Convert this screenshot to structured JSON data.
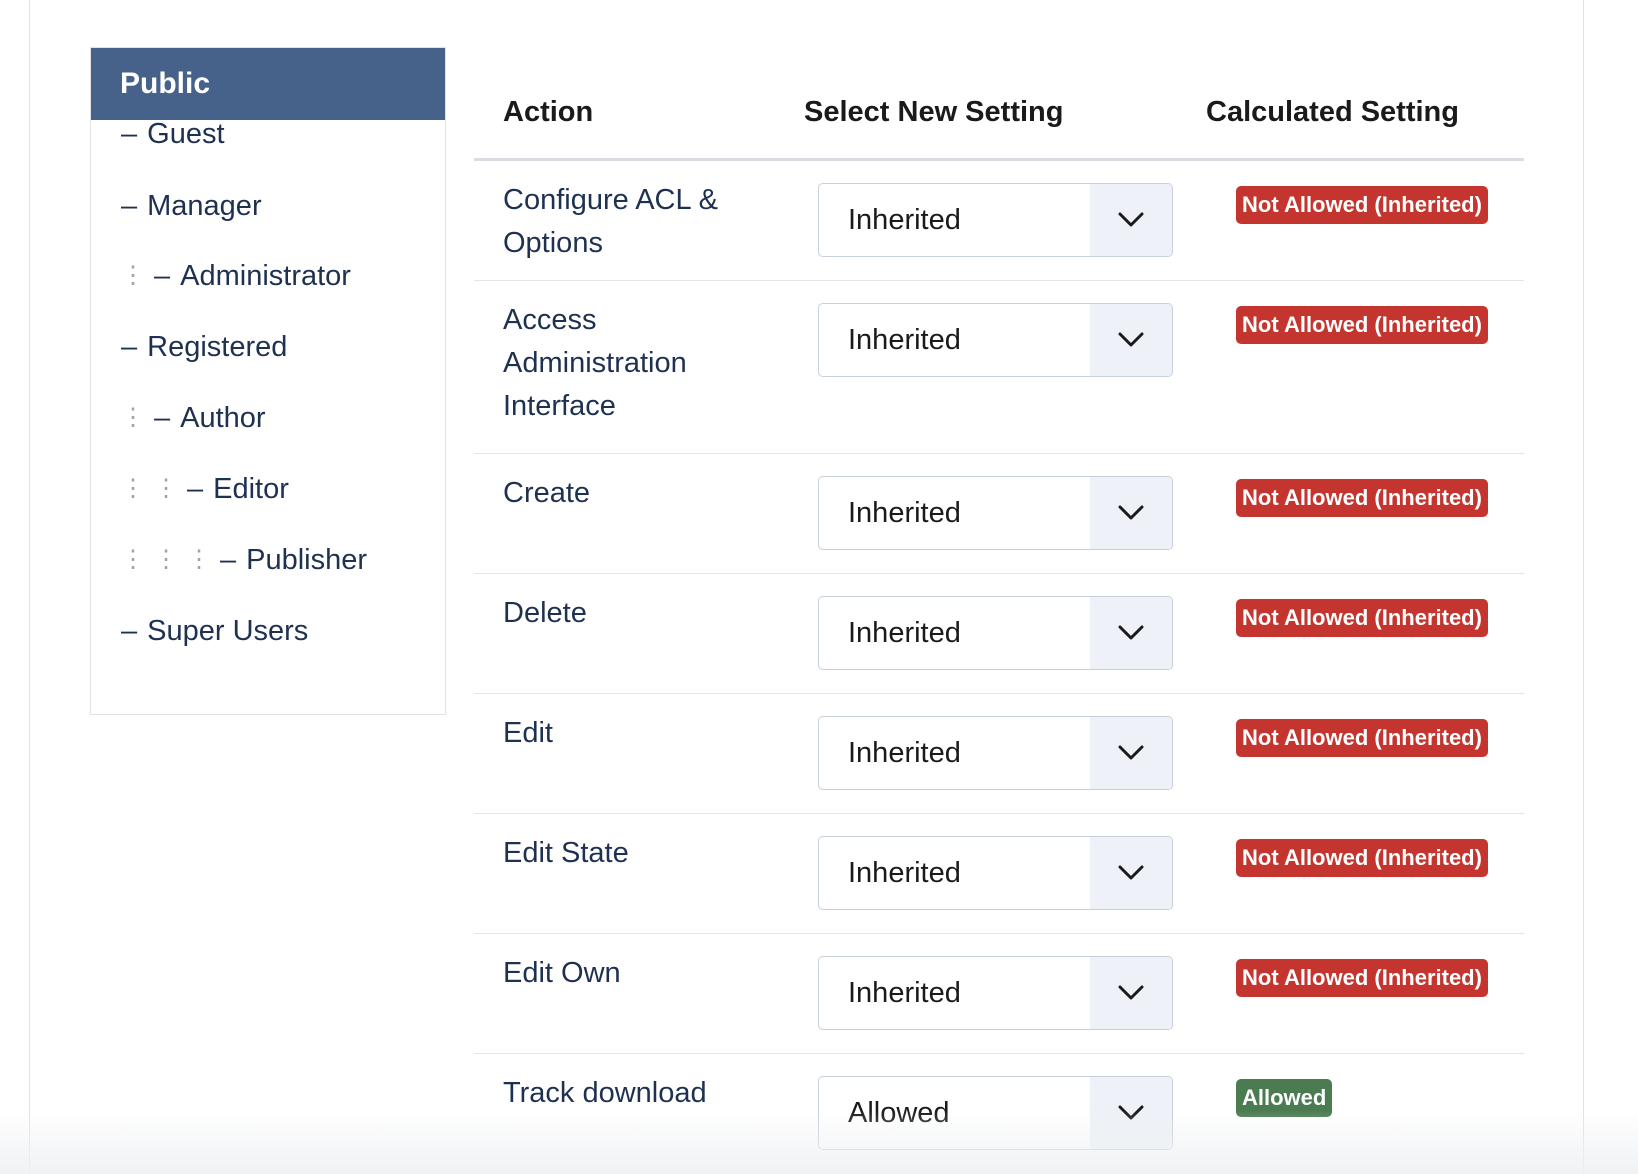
{
  "sidebar": {
    "header": "Public",
    "groups": [
      {
        "label": "Guest",
        "depth": 0
      },
      {
        "label": "Manager",
        "depth": 0
      },
      {
        "label": "Administrator",
        "depth": 1
      },
      {
        "label": "Registered",
        "depth": 0
      },
      {
        "label": "Author",
        "depth": 1
      },
      {
        "label": "Editor",
        "depth": 2
      },
      {
        "label": "Publisher",
        "depth": 3
      },
      {
        "label": "Super Users",
        "depth": 0
      }
    ]
  },
  "table": {
    "headers": {
      "action": "Action",
      "select": "Select New Setting",
      "calculated": "Calculated Setting"
    },
    "rows": [
      {
        "action": "Configure ACL & Options",
        "setting": "Inherited",
        "calculated": "Not Allowed (Inherited)",
        "status": "denied"
      },
      {
        "action": "Access Administration Interface",
        "setting": "Inherited",
        "calculated": "Not Allowed (Inherited)",
        "status": "denied"
      },
      {
        "action": "Create",
        "setting": "Inherited",
        "calculated": "Not Allowed (Inherited)",
        "status": "denied"
      },
      {
        "action": "Delete",
        "setting": "Inherited",
        "calculated": "Not Allowed (Inherited)",
        "status": "denied"
      },
      {
        "action": "Edit",
        "setting": "Inherited",
        "calculated": "Not Allowed (Inherited)",
        "status": "denied"
      },
      {
        "action": "Edit State",
        "setting": "Inherited",
        "calculated": "Not Allowed (Inherited)",
        "status": "denied"
      },
      {
        "action": "Edit Own",
        "setting": "Inherited",
        "calculated": "Not Allowed (Inherited)",
        "status": "denied"
      },
      {
        "action": "Track download",
        "setting": "Allowed",
        "calculated": "Allowed",
        "status": "allowed"
      }
    ]
  },
  "colors": {
    "header_bg": "#46628a",
    "denied": "#c3352e",
    "allowed": "#4b7c51"
  },
  "icons": {
    "select_arrow": "chevron-down-icon",
    "tree_guide": "vertical-dots"
  }
}
